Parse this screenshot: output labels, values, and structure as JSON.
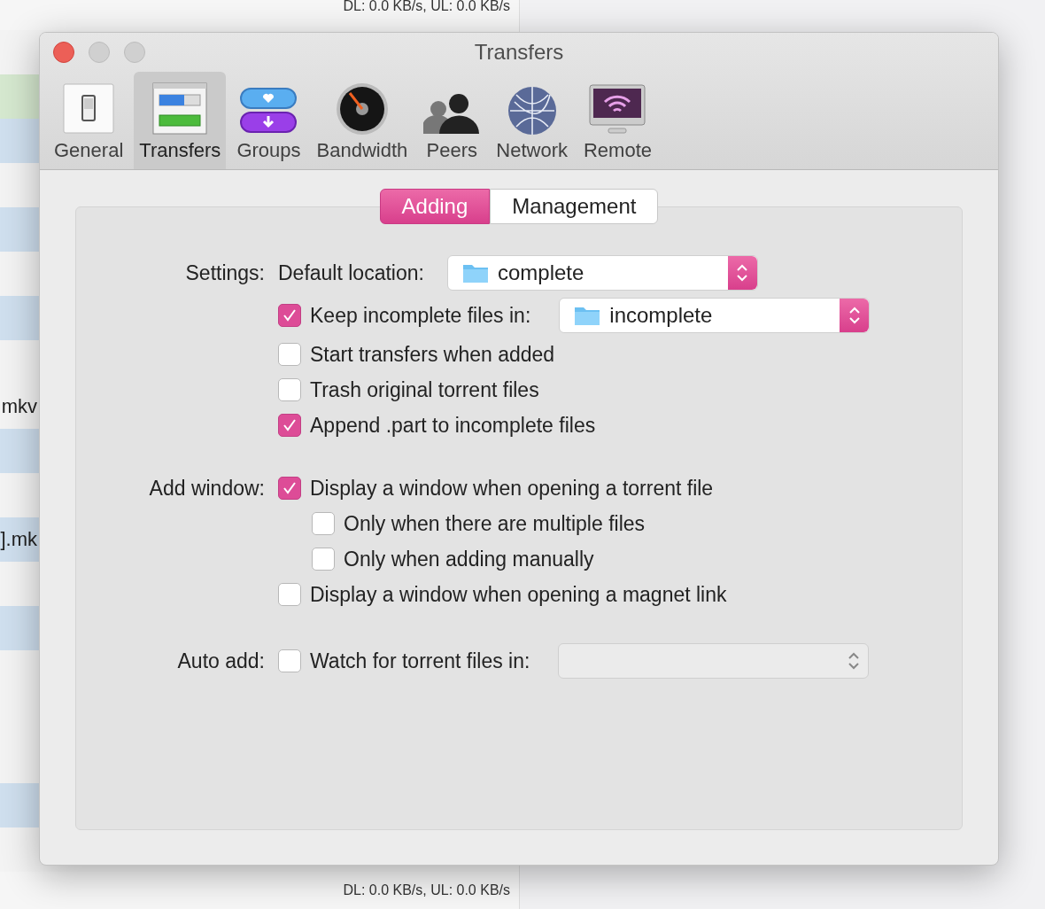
{
  "background": {
    "status_top": "DL: 0.0 KB/s, UL: 0.0 KB/s",
    "status_bottom": "DL: 0.0 KB/s, UL: 0.0 KB/s",
    "rows": [
      {
        "color": "#f3f3f3"
      },
      {
        "color": "#d5e8cf"
      },
      {
        "color": "#cfdfee"
      },
      {
        "color": "#f3f3f3"
      },
      {
        "color": "#cfdfee"
      },
      {
        "color": "#f3f3f3"
      },
      {
        "color": "#cfdfee"
      },
      {
        "color": "#f3f3f3"
      },
      {
        "color": "#f3f3f3",
        "text": "mkv"
      },
      {
        "color": "#cfdfee"
      },
      {
        "color": "#f3f3f3"
      },
      {
        "color": "#cfdfee",
        "text": "].mk"
      },
      {
        "color": "#f3f3f3"
      },
      {
        "color": "#cfdfee"
      },
      {
        "color": "#f3f3f3"
      },
      {
        "color": "#f3f3f3"
      },
      {
        "color": "#f3f3f3"
      },
      {
        "color": "#cfdfee"
      },
      {
        "color": "#f3f3f3"
      }
    ]
  },
  "window": {
    "title": "Transfers"
  },
  "toolbar": [
    {
      "label": "General",
      "selected": false
    },
    {
      "label": "Transfers",
      "selected": true
    },
    {
      "label": "Groups",
      "selected": false
    },
    {
      "label": "Bandwidth",
      "selected": false
    },
    {
      "label": "Peers",
      "selected": false
    },
    {
      "label": "Network",
      "selected": false
    },
    {
      "label": "Remote",
      "selected": false
    }
  ],
  "segments": [
    {
      "label": "Adding",
      "selected": true
    },
    {
      "label": "Management",
      "selected": false
    }
  ],
  "sections": [
    {
      "label": "Settings:",
      "options": [
        {
          "kind": "popup",
          "label": "Default location:",
          "popup": {
            "value": "complete",
            "disabled": false
          }
        },
        {
          "kind": "checkbox_popup",
          "label": "Keep incomplete files in:",
          "checked": true,
          "popup": {
            "value": "incomplete",
            "disabled": false
          }
        },
        {
          "kind": "checkbox",
          "label": "Start transfers when added",
          "checked": false
        },
        {
          "kind": "checkbox",
          "label": "Trash original torrent files",
          "checked": false
        },
        {
          "kind": "checkbox",
          "label": "Append .part to incomplete files",
          "checked": true
        }
      ]
    },
    {
      "label": "Add window:",
      "options": [
        {
          "kind": "checkbox",
          "label": "Display a window when opening a torrent file",
          "checked": true,
          "children": [
            {
              "kind": "checkbox",
              "label": "Only when there are multiple files",
              "checked": false
            },
            {
              "kind": "checkbox",
              "label": "Only when adding manually",
              "checked": false
            }
          ]
        },
        {
          "kind": "checkbox",
          "label": "Display a window when opening a magnet link",
          "checked": false
        }
      ]
    },
    {
      "label": "Auto add:",
      "options": [
        {
          "kind": "checkbox_popup",
          "label": "Watch for torrent files in:",
          "checked": false,
          "popup": {
            "disabled": true
          }
        }
      ]
    }
  ]
}
